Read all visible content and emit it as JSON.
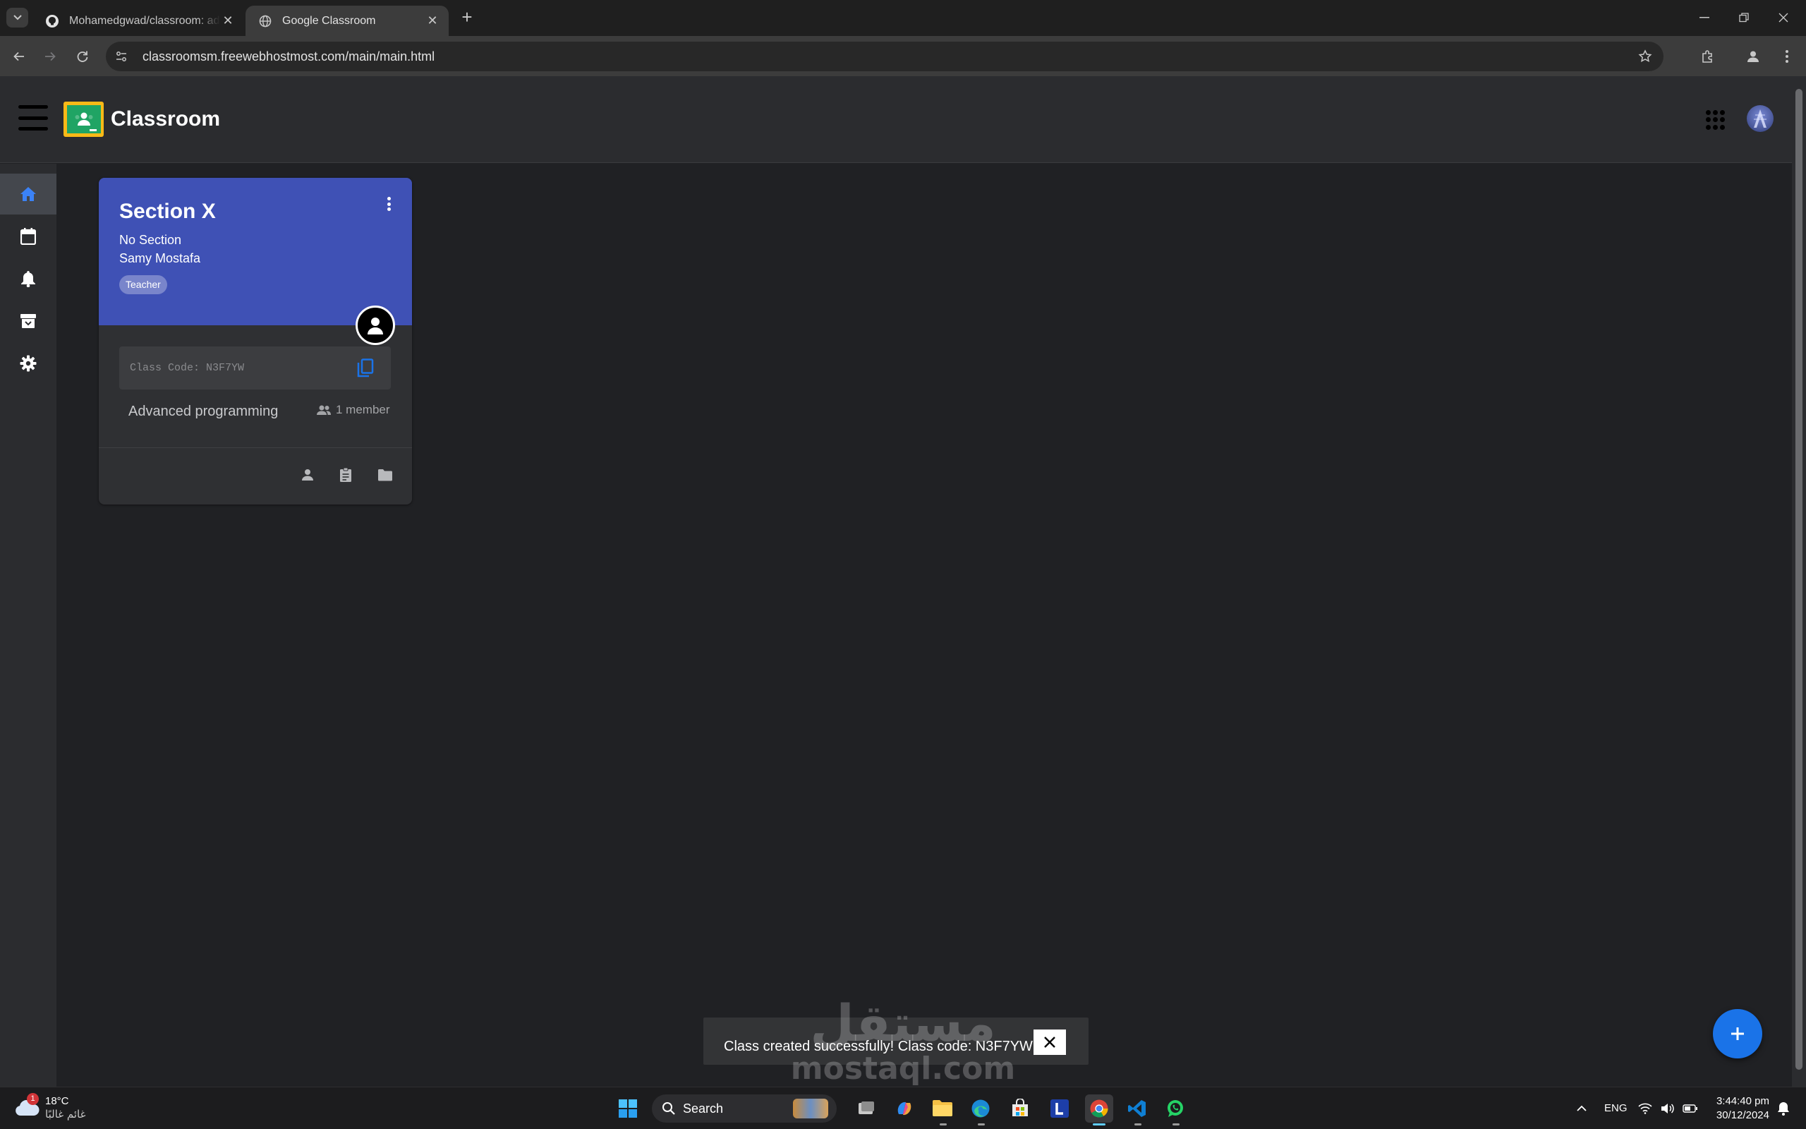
{
  "browser": {
    "tabs": [
      {
        "title": "Mohamedgwad/classroom: advanced programming",
        "active": false,
        "favicon": "github-icon"
      },
      {
        "title": "Google Classroom",
        "active": true,
        "favicon": "globe-icon"
      }
    ],
    "url": "classroomsm.freewebhostmost.com/main/main.html"
  },
  "app": {
    "title": "Classroom",
    "sidebar": [
      "home-icon",
      "calendar-icon",
      "bell-icon",
      "archive-icon",
      "settings-icon"
    ]
  },
  "card": {
    "title": "Section X",
    "section": "No Section",
    "teacher": "Samy Mostafa",
    "role": "Teacher",
    "code_label": "Class Code: N3F7YW",
    "class_name": "Advanced programming",
    "members": "1 member",
    "banner_color": "#3f51b5"
  },
  "snackbar": {
    "message": "Class created successfully! Class code: N3F7YW",
    "close_label": "✕"
  },
  "watermark": {
    "arabic": "مستقل",
    "latin": "mostaql.com"
  },
  "taskbar": {
    "weather_temp": "18°C",
    "weather_cond": "غائم غالبًا",
    "weather_badge": "1",
    "search_label": "Search",
    "language": "ENG",
    "time": "3:44:40 pm",
    "date": "30/12/2024"
  },
  "colors": {
    "accent": "#1a73e8",
    "background": "#202124"
  }
}
